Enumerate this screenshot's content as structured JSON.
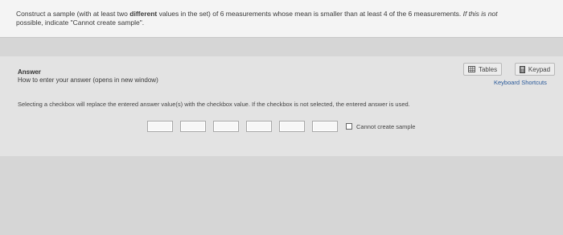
{
  "question": {
    "part1": "Construct a sample (with at least two ",
    "bold": "different",
    "part2": " values in the set) of 6 measurements whose mean is smaller than at least 4 of the 6 measurements. ",
    "italic": "If this is not",
    "line2": "possible, indicate \"Cannot create sample\"."
  },
  "answer": {
    "label": "Answer",
    "help_link": "How to enter your answer (opens in new window)",
    "tables_label": "Tables",
    "keypad_label": "Keypad",
    "shortcuts_label": "Keyboard Shortcuts",
    "instruction": "Selecting a checkbox will replace the entered answer value(s) with the checkbox value. If the checkbox is not selected, the entered answer is used.",
    "inputs": [
      "",
      "",
      "",
      "",
      "",
      ""
    ],
    "checkbox_label": "Cannot create sample",
    "checkbox_checked": false
  }
}
